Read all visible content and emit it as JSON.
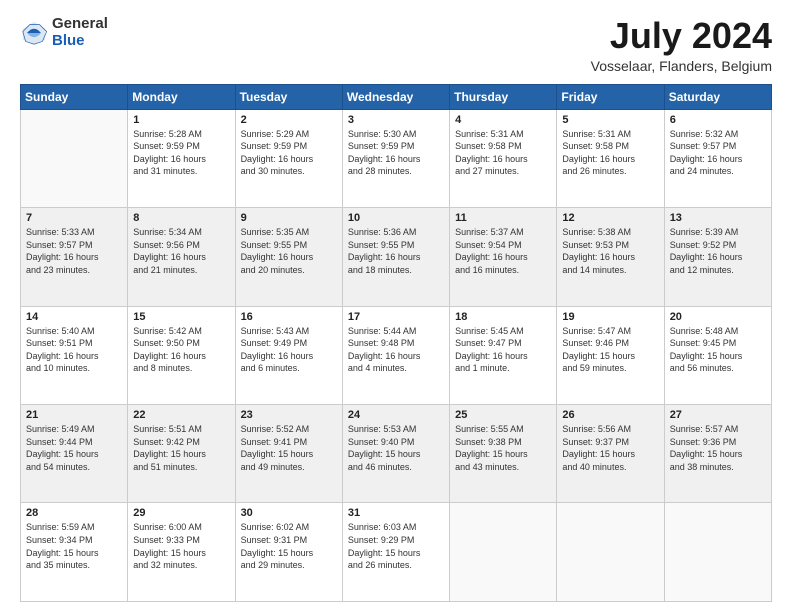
{
  "logo": {
    "general": "General",
    "blue": "Blue"
  },
  "header": {
    "month": "July 2024",
    "location": "Vosselaar, Flanders, Belgium"
  },
  "weekdays": [
    "Sunday",
    "Monday",
    "Tuesday",
    "Wednesday",
    "Thursday",
    "Friday",
    "Saturday"
  ],
  "weeks": [
    [
      {
        "day": "",
        "info": ""
      },
      {
        "day": "1",
        "info": "Sunrise: 5:28 AM\nSunset: 9:59 PM\nDaylight: 16 hours\nand 31 minutes."
      },
      {
        "day": "2",
        "info": "Sunrise: 5:29 AM\nSunset: 9:59 PM\nDaylight: 16 hours\nand 30 minutes."
      },
      {
        "day": "3",
        "info": "Sunrise: 5:30 AM\nSunset: 9:59 PM\nDaylight: 16 hours\nand 28 minutes."
      },
      {
        "day": "4",
        "info": "Sunrise: 5:31 AM\nSunset: 9:58 PM\nDaylight: 16 hours\nand 27 minutes."
      },
      {
        "day": "5",
        "info": "Sunrise: 5:31 AM\nSunset: 9:58 PM\nDaylight: 16 hours\nand 26 minutes."
      },
      {
        "day": "6",
        "info": "Sunrise: 5:32 AM\nSunset: 9:57 PM\nDaylight: 16 hours\nand 24 minutes."
      }
    ],
    [
      {
        "day": "7",
        "info": "Sunrise: 5:33 AM\nSunset: 9:57 PM\nDaylight: 16 hours\nand 23 minutes."
      },
      {
        "day": "8",
        "info": "Sunrise: 5:34 AM\nSunset: 9:56 PM\nDaylight: 16 hours\nand 21 minutes."
      },
      {
        "day": "9",
        "info": "Sunrise: 5:35 AM\nSunset: 9:55 PM\nDaylight: 16 hours\nand 20 minutes."
      },
      {
        "day": "10",
        "info": "Sunrise: 5:36 AM\nSunset: 9:55 PM\nDaylight: 16 hours\nand 18 minutes."
      },
      {
        "day": "11",
        "info": "Sunrise: 5:37 AM\nSunset: 9:54 PM\nDaylight: 16 hours\nand 16 minutes."
      },
      {
        "day": "12",
        "info": "Sunrise: 5:38 AM\nSunset: 9:53 PM\nDaylight: 16 hours\nand 14 minutes."
      },
      {
        "day": "13",
        "info": "Sunrise: 5:39 AM\nSunset: 9:52 PM\nDaylight: 16 hours\nand 12 minutes."
      }
    ],
    [
      {
        "day": "14",
        "info": "Sunrise: 5:40 AM\nSunset: 9:51 PM\nDaylight: 16 hours\nand 10 minutes."
      },
      {
        "day": "15",
        "info": "Sunrise: 5:42 AM\nSunset: 9:50 PM\nDaylight: 16 hours\nand 8 minutes."
      },
      {
        "day": "16",
        "info": "Sunrise: 5:43 AM\nSunset: 9:49 PM\nDaylight: 16 hours\nand 6 minutes."
      },
      {
        "day": "17",
        "info": "Sunrise: 5:44 AM\nSunset: 9:48 PM\nDaylight: 16 hours\nand 4 minutes."
      },
      {
        "day": "18",
        "info": "Sunrise: 5:45 AM\nSunset: 9:47 PM\nDaylight: 16 hours\nand 1 minute."
      },
      {
        "day": "19",
        "info": "Sunrise: 5:47 AM\nSunset: 9:46 PM\nDaylight: 15 hours\nand 59 minutes."
      },
      {
        "day": "20",
        "info": "Sunrise: 5:48 AM\nSunset: 9:45 PM\nDaylight: 15 hours\nand 56 minutes."
      }
    ],
    [
      {
        "day": "21",
        "info": "Sunrise: 5:49 AM\nSunset: 9:44 PM\nDaylight: 15 hours\nand 54 minutes."
      },
      {
        "day": "22",
        "info": "Sunrise: 5:51 AM\nSunset: 9:42 PM\nDaylight: 15 hours\nand 51 minutes."
      },
      {
        "day": "23",
        "info": "Sunrise: 5:52 AM\nSunset: 9:41 PM\nDaylight: 15 hours\nand 49 minutes."
      },
      {
        "day": "24",
        "info": "Sunrise: 5:53 AM\nSunset: 9:40 PM\nDaylight: 15 hours\nand 46 minutes."
      },
      {
        "day": "25",
        "info": "Sunrise: 5:55 AM\nSunset: 9:38 PM\nDaylight: 15 hours\nand 43 minutes."
      },
      {
        "day": "26",
        "info": "Sunrise: 5:56 AM\nSunset: 9:37 PM\nDaylight: 15 hours\nand 40 minutes."
      },
      {
        "day": "27",
        "info": "Sunrise: 5:57 AM\nSunset: 9:36 PM\nDaylight: 15 hours\nand 38 minutes."
      }
    ],
    [
      {
        "day": "28",
        "info": "Sunrise: 5:59 AM\nSunset: 9:34 PM\nDaylight: 15 hours\nand 35 minutes."
      },
      {
        "day": "29",
        "info": "Sunrise: 6:00 AM\nSunset: 9:33 PM\nDaylight: 15 hours\nand 32 minutes."
      },
      {
        "day": "30",
        "info": "Sunrise: 6:02 AM\nSunset: 9:31 PM\nDaylight: 15 hours\nand 29 minutes."
      },
      {
        "day": "31",
        "info": "Sunrise: 6:03 AM\nSunset: 9:29 PM\nDaylight: 15 hours\nand 26 minutes."
      },
      {
        "day": "",
        "info": ""
      },
      {
        "day": "",
        "info": ""
      },
      {
        "day": "",
        "info": ""
      }
    ]
  ]
}
